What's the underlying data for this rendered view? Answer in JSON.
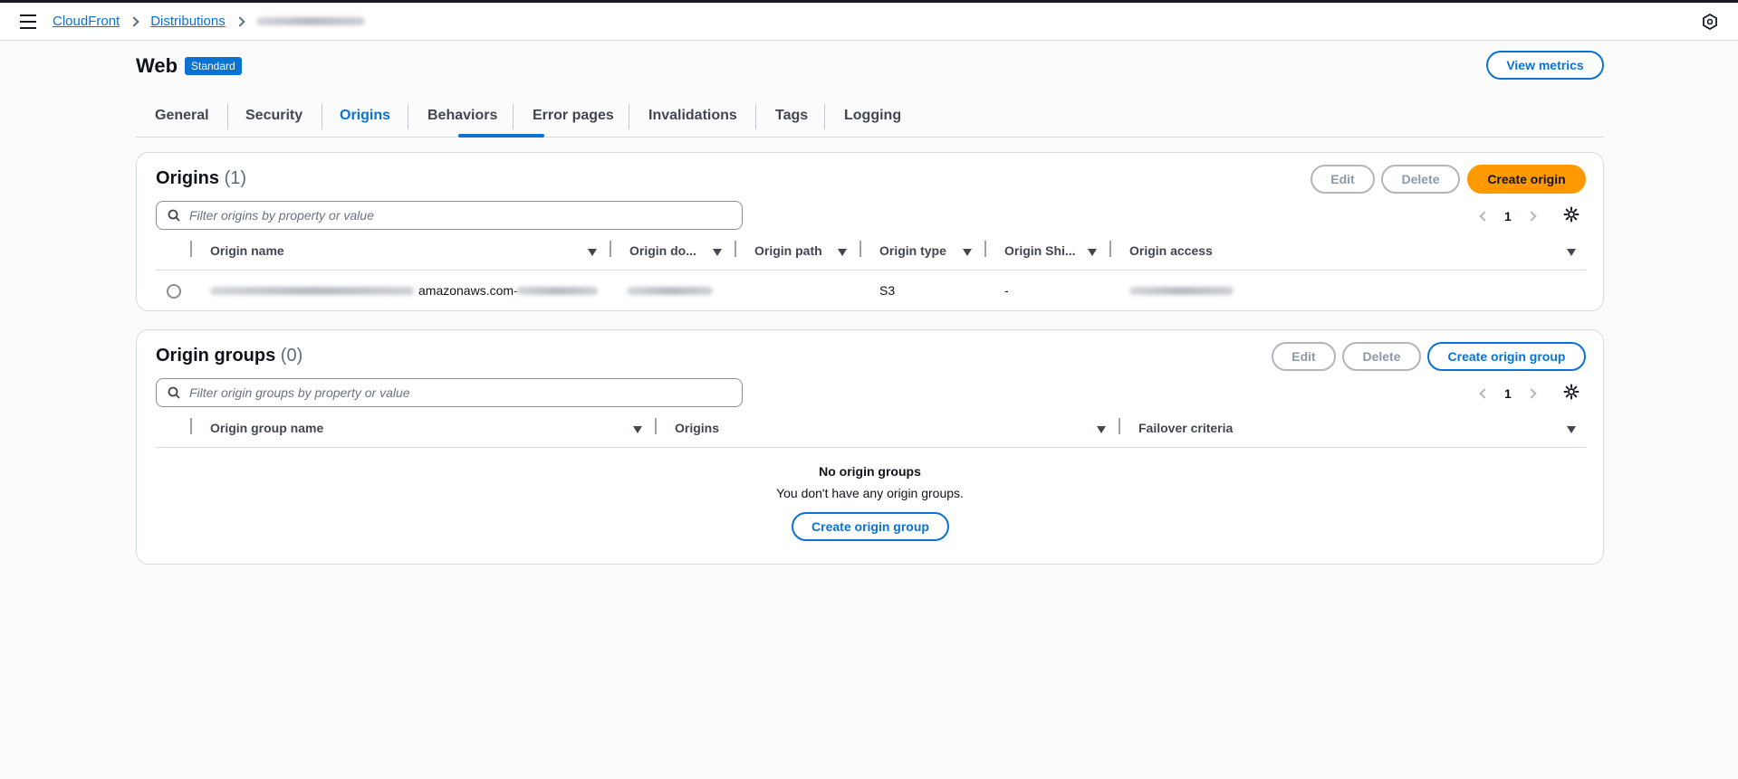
{
  "breadcrumb": {
    "items": [
      "CloudFront",
      "Distributions"
    ]
  },
  "page": {
    "title": "Web",
    "badge": "Standard",
    "view_metrics_label": "View metrics"
  },
  "tabs": [
    "General",
    "Security",
    "Origins",
    "Behaviors",
    "Error pages",
    "Invalidations",
    "Tags",
    "Logging"
  ],
  "active_tab": "Origins",
  "origins": {
    "title": "Origins",
    "count": "(1)",
    "edit_label": "Edit",
    "delete_label": "Delete",
    "create_label": "Create origin",
    "filter_placeholder": "Filter origins by property or value",
    "page": "1",
    "columns": [
      "Origin name",
      "Origin do...",
      "Origin path",
      "Origin type",
      "Origin Shi...",
      "Origin access"
    ],
    "rows": [
      {
        "name_visible": "amazonaws.com-",
        "origin_type": "S3",
        "origin_shield": "-"
      }
    ]
  },
  "origin_groups": {
    "title": "Origin groups",
    "count": "(0)",
    "edit_label": "Edit",
    "delete_label": "Delete",
    "create_label": "Create origin group",
    "filter_placeholder": "Filter origin groups by property or value",
    "page": "1",
    "columns": [
      "Origin group name",
      "Origins",
      "Failover criteria"
    ],
    "empty_title": "No origin groups",
    "empty_message": "You don't have any origin groups.",
    "empty_create_label": "Create origin group"
  },
  "colors": {
    "accent": "#0972d3",
    "primary_button": "#ff9900"
  }
}
